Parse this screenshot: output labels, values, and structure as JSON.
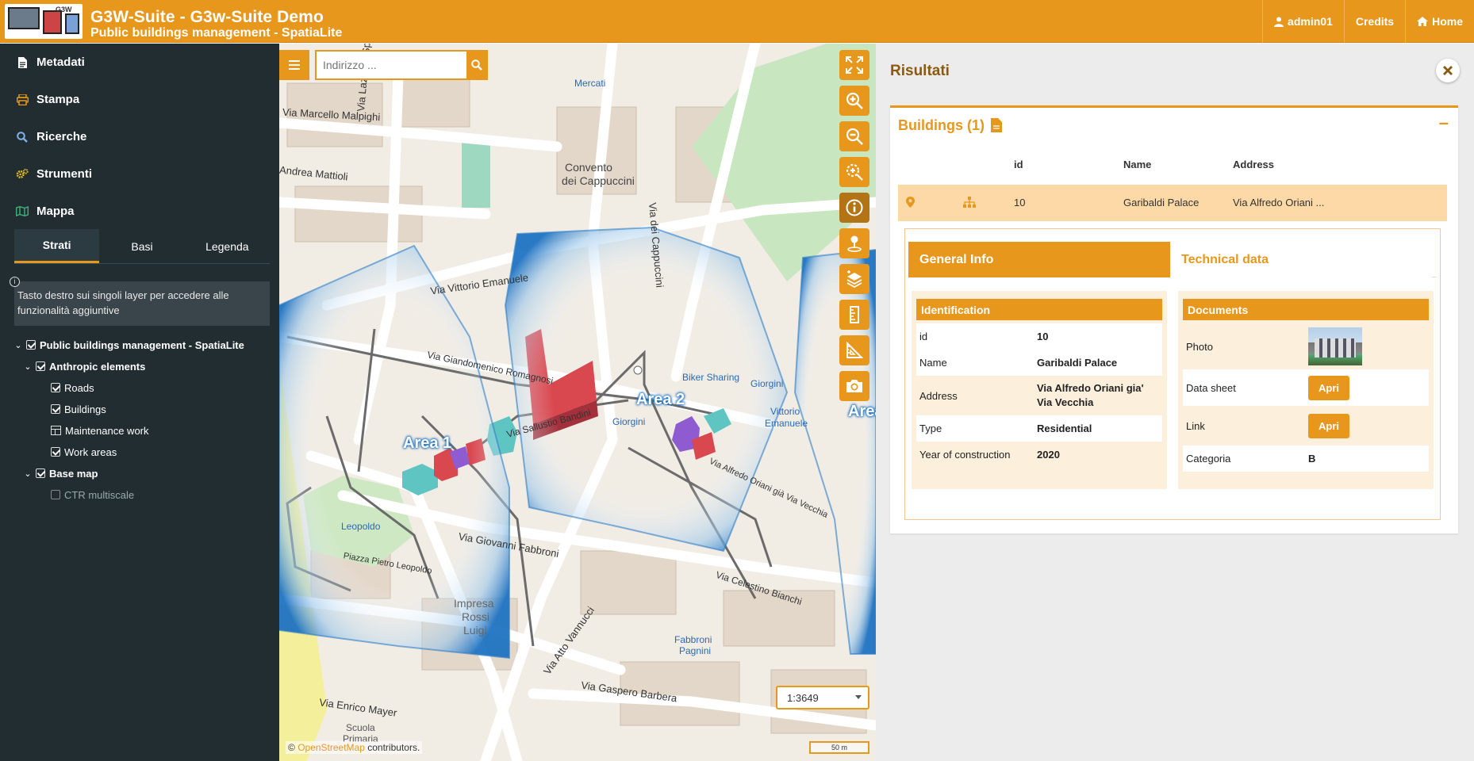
{
  "header": {
    "title": "G3W-Suite - G3w-Suite Demo",
    "subtitle": "Public buildings management - SpatiaLite",
    "logo_text": "G3W",
    "nav": [
      {
        "label": "admin01",
        "icon": "user-icon"
      },
      {
        "label": "Credits",
        "icon": ""
      },
      {
        "label": "Home",
        "icon": "home-icon"
      }
    ],
    "accent": "#e8971d"
  },
  "sidebar": {
    "menu": [
      {
        "label": "Metadati",
        "icon": "file-icon"
      },
      {
        "label": "Stampa",
        "icon": "print-icon"
      },
      {
        "label": "Ricerche",
        "icon": "search-icon"
      },
      {
        "label": "Strumenti",
        "icon": "gears-icon"
      },
      {
        "label": "Mappa",
        "icon": "map-icon"
      }
    ],
    "tabs": [
      "Strati",
      "Basi",
      "Legenda"
    ],
    "active_tab": "Strati",
    "info": "Tasto destro sui singoli layer per accedere alle funzionalità aggiuntive",
    "tree": {
      "root": "Public buildings management - SpatiaLite",
      "group1": "Anthropic elements",
      "layers": [
        "Roads",
        "Buildings",
        "Maintenance work",
        "Work areas"
      ],
      "group2": "Base map",
      "base_layer": "CTR multiscale"
    }
  },
  "map": {
    "search_placeholder": "Indirizzo ...",
    "scale": "1:3649",
    "scalebar": "50 m",
    "attribution_prefix": "©",
    "attribution_link": "OpenStreetMap",
    "attribution_suffix": "contributors.",
    "labels": {
      "area1": "Area 1",
      "area2": "Area 2",
      "area3": "Area",
      "via_marcello": "Via Marcello Malpighi",
      "andrea": "Andrea Mattioli",
      "lazzaro": "Via Lazzaro Spallanzani",
      "convento": "Convento",
      "cappuccini": "dei Cappuccini",
      "mercati": "Mercati",
      "vittorio": "Via Vittorio Emanuele",
      "romagnosi": "Via Giandomenico Romagnosi",
      "bandini": "Via Sallustio Bandini",
      "biker": "Biker Sharing",
      "giorgini": "Giorgini",
      "giorgini2": "Giorgini",
      "vittorio2": "Vittorio",
      "emanuele": "Emanuele",
      "oriani": "Via Alfredo Oriani già Via Vecchia",
      "fabbroni": "Via Giovanni Fabbroni",
      "leopoldo": "Leopoldo",
      "piazza": "Piazza Pietro Leopoldo",
      "impresa": "Impresa",
      "rossi": "Rossi",
      "luigi": "Luigi",
      "fabbroni2": "Fabbroni",
      "pagnini": "Pagnini",
      "barbera": "Via Gaspero Barbera",
      "mayer": "Via Enrico Mayer",
      "vannucci": "Via Atto Vannucci",
      "celestino": "Via Celestino Bianchi",
      "scuola": "Scuola",
      "primaria": "Primaria",
      "cappuccini_v": "Via dei Cappuccini"
    }
  },
  "results": {
    "title": "Risultati",
    "layer_title": "Buildings (1)",
    "columns": [
      "id",
      "Name",
      "Address"
    ],
    "row": {
      "id": "10",
      "name": "Garibaldi Palace",
      "address": "Via Alfredo Oriani ..."
    },
    "tabs": [
      "General Info",
      "Technical data"
    ],
    "identification": {
      "header": "Identification",
      "fields": [
        {
          "key": "id",
          "value": "10"
        },
        {
          "key": "Name",
          "value": "Garibaldi Palace"
        },
        {
          "key": "Address",
          "value": "Via Alfredo Oriani gia' Via Vecchia"
        },
        {
          "key": "Type",
          "value": "Residential"
        },
        {
          "key": "Year of construction",
          "value": "2020"
        }
      ]
    },
    "documents": {
      "header": "Documents",
      "photo_label": "Photo",
      "datasheet_label": "Data sheet",
      "link_label": "Link",
      "button": "Apri",
      "categoria_label": "Categoria",
      "categoria_value": "B"
    }
  }
}
